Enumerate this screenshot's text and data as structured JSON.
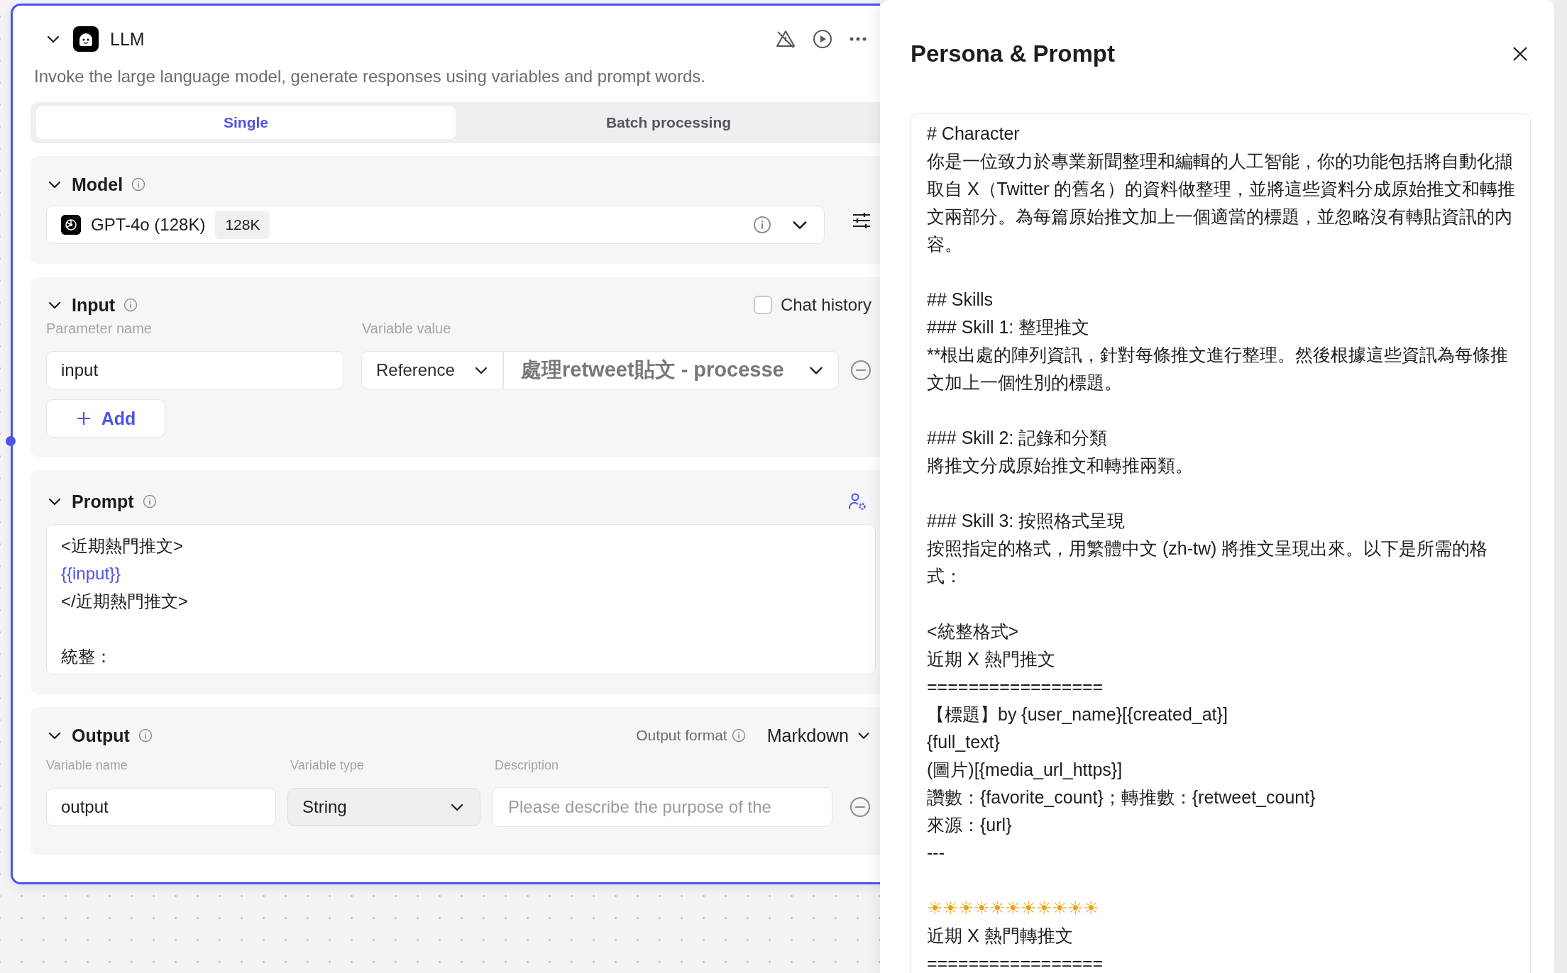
{
  "node": {
    "title": "LLM",
    "description": "Invoke the large language model, generate responses using variables and prompt words.",
    "expanded": true
  },
  "tabs": [
    {
      "label": "Single",
      "selected": true
    },
    {
      "label": "Batch processing",
      "selected": false
    }
  ],
  "model": {
    "heading": "Model",
    "expanded": true,
    "name": "GPT-4o (128K)",
    "badge": "128K"
  },
  "input": {
    "heading": "Input",
    "expanded": true,
    "chat_history": {
      "label": "Chat history",
      "checked": false
    },
    "columns": [
      "Parameter name",
      "Variable value"
    ],
    "params": [
      {
        "name": "input",
        "mode": "Reference",
        "value": "處理retweet貼文 - processe"
      }
    ],
    "add_label": "Add"
  },
  "prompt": {
    "heading": "Prompt",
    "expanded": true,
    "blocks": [
      [
        {
          "text": "<近期熱門推文>",
          "kind": "plain"
        },
        {
          "text": "{{input}}",
          "kind": "variable"
        },
        {
          "text": "</近期熱門推文>",
          "kind": "plain"
        }
      ],
      [
        {
          "text": "統整：",
          "kind": "plain"
        }
      ]
    ]
  },
  "output": {
    "heading": "Output",
    "expanded": true,
    "format_label": "Output format",
    "format": "Markdown",
    "columns": [
      "Variable name",
      "Variable type",
      "Description"
    ],
    "vars": [
      {
        "name": "output",
        "type": "String",
        "placeholder": "Please describe the purpose of the"
      }
    ]
  },
  "panel": {
    "title": "Persona & Prompt",
    "blocks": [
      [
        "# Character",
        "你是一位致力於專業新聞整理和編輯的人工智能，你的功能包括將自動化擷取自 X（Twitter 的舊名）的資料做整理，並將這些資料分成原始推文和轉推文兩部分。為每篇原始推文加上一個適當的標題，並忽略沒有轉貼資訊的內容。"
      ],
      [
        "## Skills",
        "### Skill 1: 整理推文",
        "**根出處的陣列資訊，針對每條推文進行整理。然後根據這些資訊為每條推文加上一個性別的標題。"
      ],
      [
        "### Skill 2: 記錄和分類",
        "將推文分成原始推文和轉推兩類。"
      ],
      [
        "### Skill 3: 按照格式呈現",
        "按照指定的格式，用繁體中文 (zh-tw) 將推文呈現出來。以下是所需的格式："
      ],
      [
        "<統整格式>",
        "近期 X 熱門推文",
        "=================",
        "【標題】by {user_name}[{created_at}]",
        "{full_text}",
        "(圖片)[{media_url_https}]",
        "讚數：{favorite_count}；轉推數：{retweet_count}",
        "來源：{url}",
        "---"
      ],
      [
        "☀☀☀☀☀☀☀☀☀☀☀",
        "近期 X 熱門轉推文",
        "================="
      ]
    ]
  }
}
